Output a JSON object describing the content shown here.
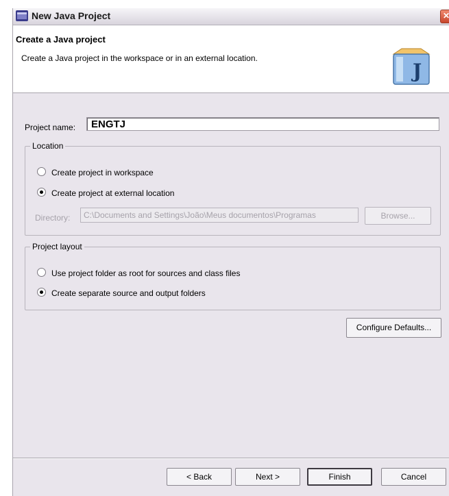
{
  "window": {
    "title": "New Java Project",
    "close_glyph": "✕"
  },
  "header": {
    "title": "Create a Java project",
    "description": "Create a Java project in the workspace or in an external location.",
    "icon": "java-project-icon",
    "icon_letter": "J"
  },
  "project_name": {
    "label": "Project name:",
    "value": "ENGTJ"
  },
  "location": {
    "legend": "Location",
    "options": [
      {
        "label": "Create project in workspace",
        "selected": false
      },
      {
        "label": "Create project at external location",
        "selected": true
      }
    ],
    "directory_label": "Directory:",
    "directory_value": "C:\\Documents and Settings\\João\\Meus documentos\\Programas",
    "browse_label": "Browse..."
  },
  "project_layout": {
    "legend": "Project layout",
    "options": [
      {
        "label": "Use project folder as root for sources and class files",
        "selected": false
      },
      {
        "label": "Create separate source and output folders",
        "selected": true
      }
    ]
  },
  "configure_defaults_label": "Configure Defaults...",
  "buttons": {
    "back": "< Back",
    "next": "Next >",
    "finish": "Finish",
    "cancel": "Cancel"
  },
  "colors": {
    "dialog_bg": "#e9e5ec",
    "header_bg": "#ffffff",
    "disabled_text": "#a6a2aa"
  }
}
